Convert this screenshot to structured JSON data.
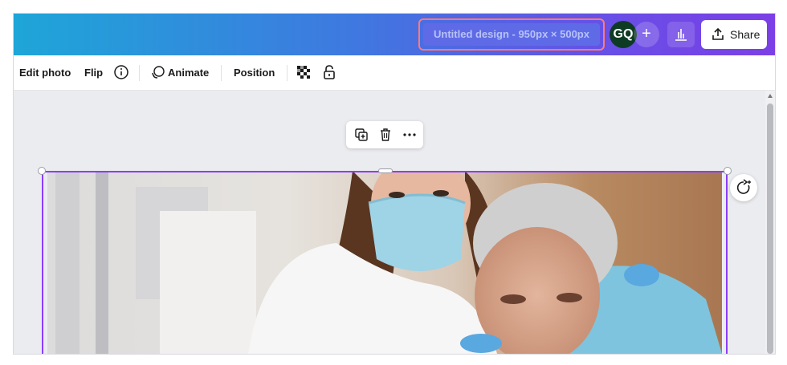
{
  "header": {
    "design_title": "Untitled design - 950px × 500px",
    "avatar_initials": "GQ",
    "add_label": "+",
    "share_label": "Share",
    "gradient_start": "#1ea6d8",
    "gradient_end": "#7b3fe6"
  },
  "toolbar": {
    "edit_photo_label": "Edit photo",
    "flip_label": "Flip",
    "info_icon": "info-icon",
    "animate_label": "Animate",
    "position_label": "Position",
    "transparency_icon": "transparency-icon",
    "lock_icon": "lock-icon"
  },
  "canvas": {
    "floating_toolbar_icons": [
      "duplicate-icon",
      "delete-icon",
      "more-icon"
    ],
    "image_description_icon": "photo",
    "selection_color": "#8b3dff"
  }
}
